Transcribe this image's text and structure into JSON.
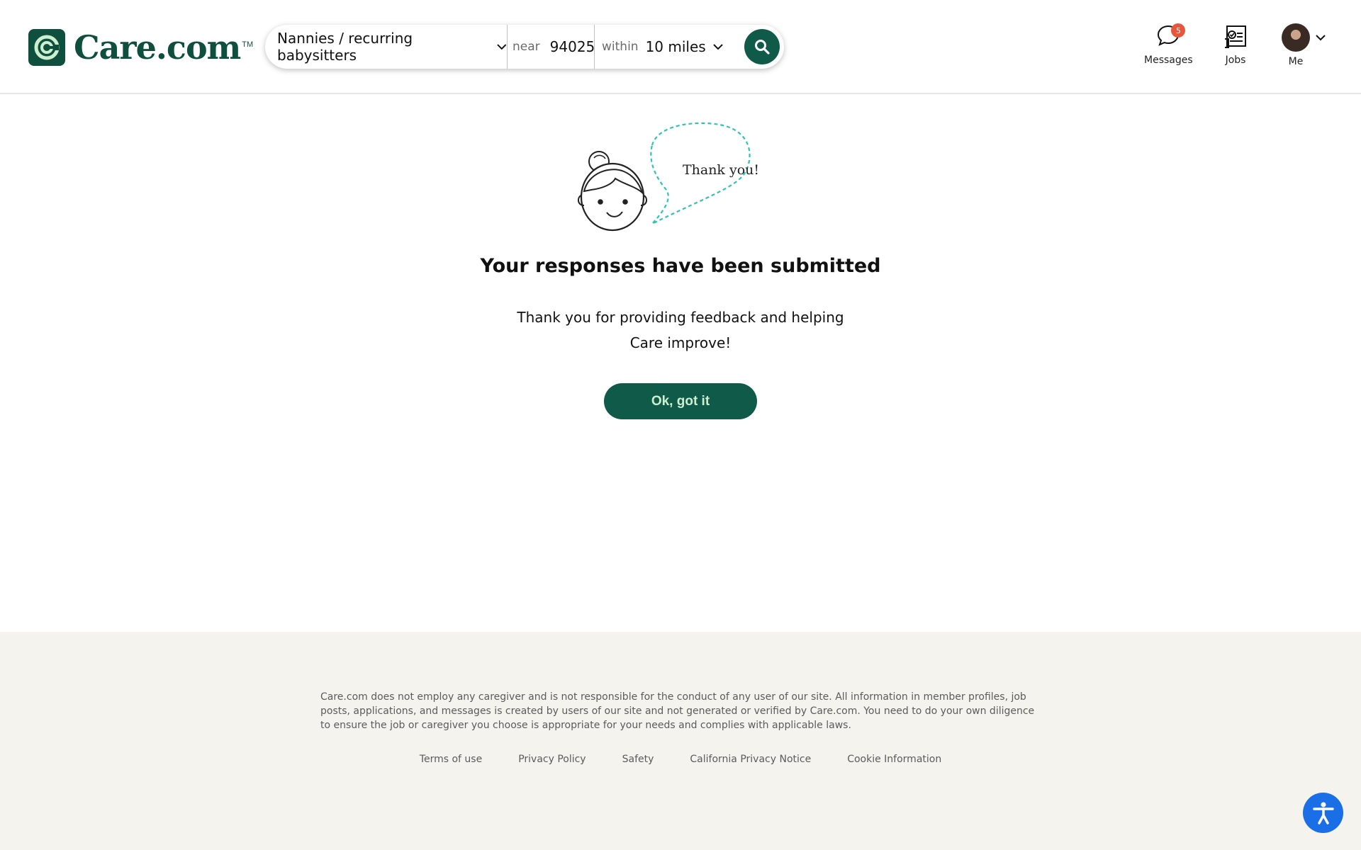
{
  "brand": {
    "name": "Care.com",
    "tm": "TM",
    "color": "#0f4f3e"
  },
  "search": {
    "service": "Nannies / recurring babysitters",
    "near_label": "near",
    "zip": "94025",
    "within_label": "within",
    "distance": "10 miles",
    "search_icon": "search-icon"
  },
  "nav": {
    "messages": {
      "label": "Messages",
      "badge": "5",
      "icon": "chat-bubble-icon"
    },
    "jobs": {
      "label": "Jobs",
      "icon": "clipboard-check-icon"
    },
    "me": {
      "label": "Me",
      "icon": "avatar"
    }
  },
  "main": {
    "speech": "Thank you!",
    "title": "Your responses have been submitted",
    "subtitle": "Thank you for providing feedback and helping Care improve!",
    "button": "Ok, got it"
  },
  "footer": {
    "disclaimer": "Care.com does not employ any caregiver and is not responsible for the conduct of any user of our site. All information in member profiles, job posts, applications, and messages is created by users of our site and not generated or verified by Care.com. You need to do your own diligence to ensure the job or caregiver you choose is appropriate for your needs and complies with applicable laws.",
    "links": [
      "Terms of use",
      "Privacy Policy",
      "Safety",
      "California Privacy Notice",
      "Cookie Information"
    ]
  },
  "colors": {
    "primary": "#0f5a48",
    "badge": "#e8553d",
    "accessibility": "#1a6fe6",
    "footer_bg": "#f5f3ee"
  }
}
